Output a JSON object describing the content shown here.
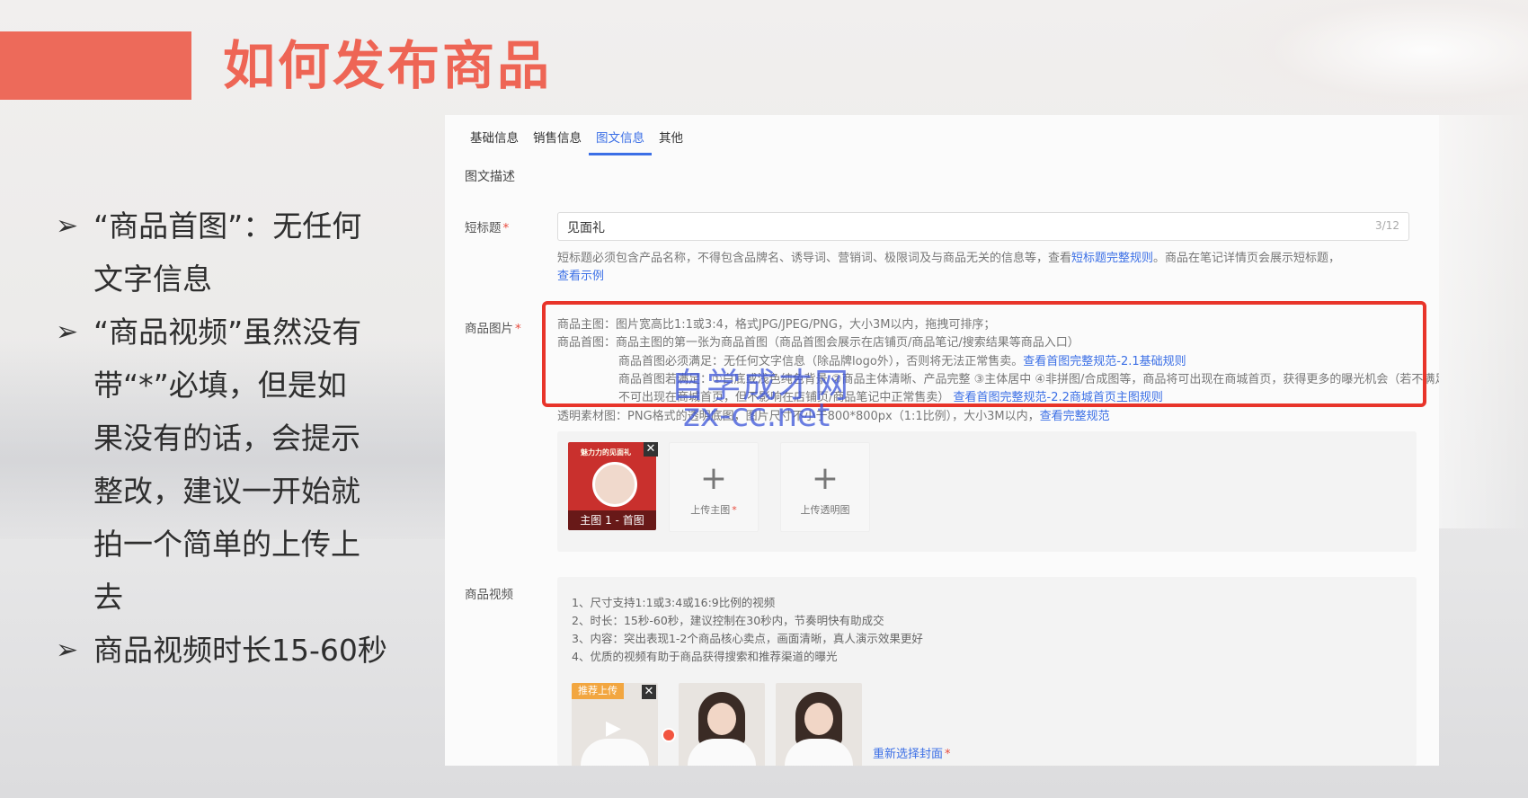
{
  "slide": {
    "title": "如何发布商品",
    "bullets": [
      "“商品首图”：无任何文字信息",
      "“商品视频”虽然没有带“*”必填，但是如果没有的话，会提示整改，建议一开始就拍一个简单的上传上去",
      "商品视频时长15-60秒"
    ],
    "bullet_icon": "arrow-bullet-icon"
  },
  "watermark": {
    "line1": "自学成才网",
    "line2": "zx-cc.net"
  },
  "form": {
    "tabs": [
      {
        "label": "基础信息",
        "active": false
      },
      {
        "label": "销售信息",
        "active": false
      },
      {
        "label": "图文信息",
        "active": true
      },
      {
        "label": "其他",
        "active": false
      }
    ],
    "section_title": "图文描述",
    "short_title": {
      "label": "短标题",
      "value": "见面礼",
      "count": "3/12",
      "hint_prefix": "短标题必须包含产品名称，不得包含品牌名、诱导词、营销词、极限词及与商品无关的信息等，查看",
      "hint_link": "短标题完整规则",
      "hint_suffix": "。商品在笔记详情页会展示短标题，",
      "example_link": "查看示例"
    },
    "product_images": {
      "label": "商品图片",
      "line1": "商品主图：图片宽高比1:1或3:4，格式JPG/JPEG/PNG，大小3M以内，拖拽可排序；",
      "line2": "商品首图：商品主图的第一张为商品首图（商品首图会展示在店铺页/商品笔记/搜索结果等商品入口）",
      "line3_text": "商品首图必须满足：无任何文字信息（除品牌logo外），否则将无法正常售卖。",
      "line3_link": "查看首图完整规范-2.1基础规则",
      "line4_text": "商品首图若满足：①白底或浅色纯色背景 ②商品主体清晰、产品完整 ③主体居中 ④非拼图/合成图等，商品将可出现在商城首页，获得更多的曝光机会（若不满足",
      "line5_text": "不可出现在商城首页，但不影响在店铺页/商品笔记中正常售卖）",
      "line5_link": "查看首图完整规范-2.2商城首页主图规则",
      "line6_text": "透明素材图：PNG格式的透明底图，图片尺寸不小于800*800px（1:1比例），大小3M以内，",
      "line6_link": "查看完整规范",
      "thumb_top_text": "魅力力的见面礼",
      "thumb_caption": "主图 1 - 首图",
      "upload_main": "上传主图",
      "upload_transparent": "上传透明图"
    },
    "product_video": {
      "label": "商品视频",
      "lines": [
        "1、尺寸支持1:1或3:4或16:9比例的视频",
        "2、时长：15秒-60秒，建议控制在30秒内，节奏明快有助成交",
        "3、内容：突出表现1-2个商品核心卖点，画面清晰，真人演示效果更好",
        "4、优质的视频有助于商品获得搜索和推荐渠道的曝光"
      ],
      "badge": "推荐上传",
      "reselect_cover": "重新选择封面"
    }
  },
  "colors": {
    "accent_red": "#ee6555",
    "link_blue": "#3b6fe6",
    "highlight_box": "#e8342a"
  }
}
